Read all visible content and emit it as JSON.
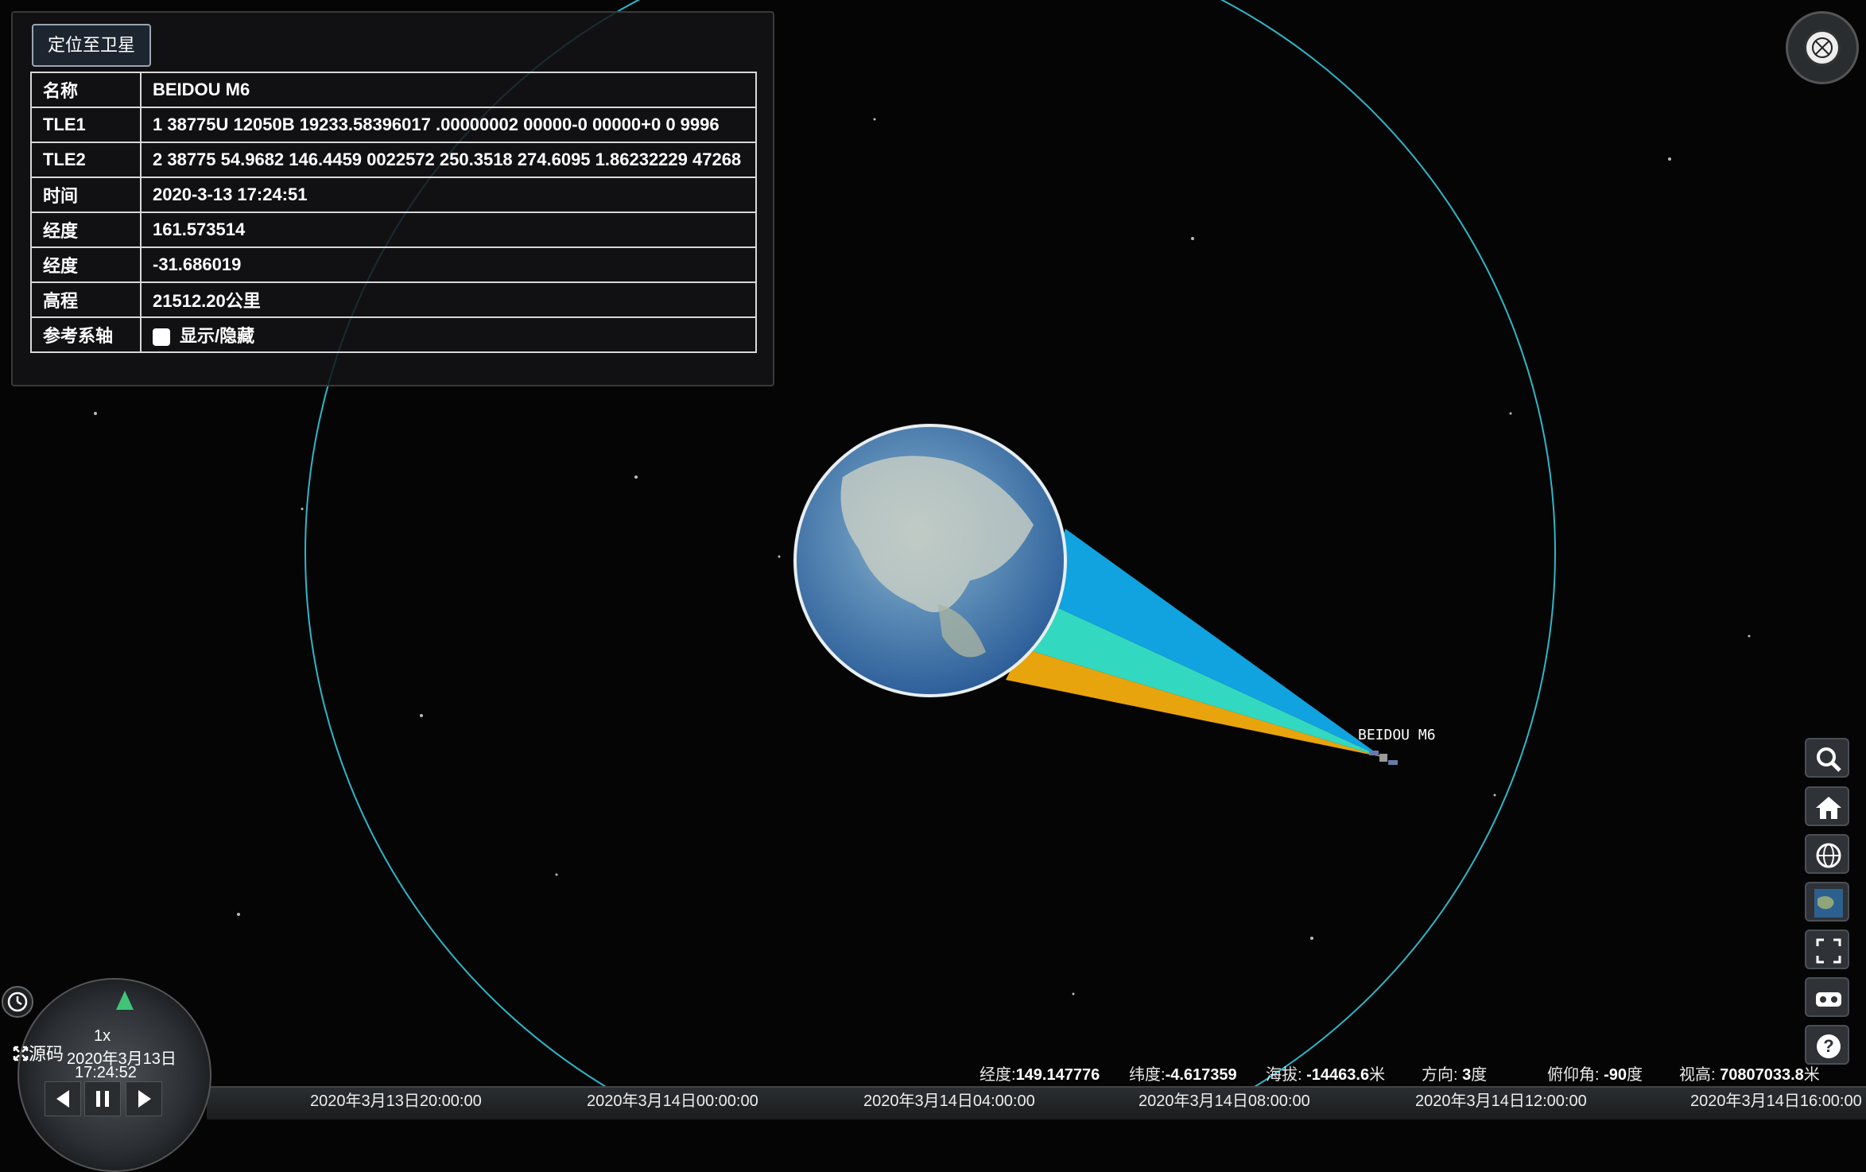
{
  "panel": {
    "locate_button": "定位至卫星",
    "rows": [
      {
        "key": "名称",
        "value": "BEIDOU M6"
      },
      {
        "key": "TLE1",
        "value": "1 38775U 12050B 19233.58396017 .00000002 00000-0 00000+0 0 9996"
      },
      {
        "key": "TLE2",
        "value": "2 38775 54.9682 146.4459 0022572 250.3518 274.6095 1.86232229 47268"
      },
      {
        "key": "时间",
        "value": "2020-3-13 17:24:51"
      },
      {
        "key": "经度",
        "value": "161.573514"
      },
      {
        "key": "经度",
        "value": "-31.686019"
      },
      {
        "key": "高程",
        "value": "21512.20公里"
      },
      {
        "key": "参考系轴",
        "value": "显示/隐藏"
      }
    ]
  },
  "satellite": {
    "label": "BEIDOU M6"
  },
  "animation": {
    "speed": "1x",
    "date": "2020年3月13日",
    "time": "17:24:52",
    "source_link": "源码"
  },
  "status": {
    "lon_label": "经度:",
    "lon_value": "149.147776",
    "lat_label": "纬度:",
    "lat_value": "-4.617359",
    "alt_label": "海拔: ",
    "alt_value": "-14463.6",
    "alt_unit": "米",
    "heading_label": "方向: ",
    "heading_value": "3",
    "heading_unit": "度",
    "pitch_label": "俯仰角: ",
    "pitch_value": "-90",
    "pitch_unit": "度",
    "height_label": "视高: ",
    "height_value": "70807033.8",
    "height_unit": "米"
  },
  "timeline": {
    "labels": [
      "2020年3月13日20:00:00",
      "2020年3月14日00:00:00",
      "2020年3月14日04:00:00",
      "2020年3月14日08:00:00",
      "2020年3月14日12:00:00",
      "2020年3月14日16:00:00"
    ]
  },
  "toolbar": {
    "icons": [
      "search-icon",
      "home-icon",
      "globe-icon",
      "base-layer-icon",
      "fullscreen-icon",
      "vr-icon",
      "help-icon"
    ]
  },
  "colors": {
    "orbit": "#2fb6c9",
    "beam_blue": "#11a2e0",
    "beam_teal": "#33d8c0",
    "beam_orange": "#e8a40c"
  }
}
